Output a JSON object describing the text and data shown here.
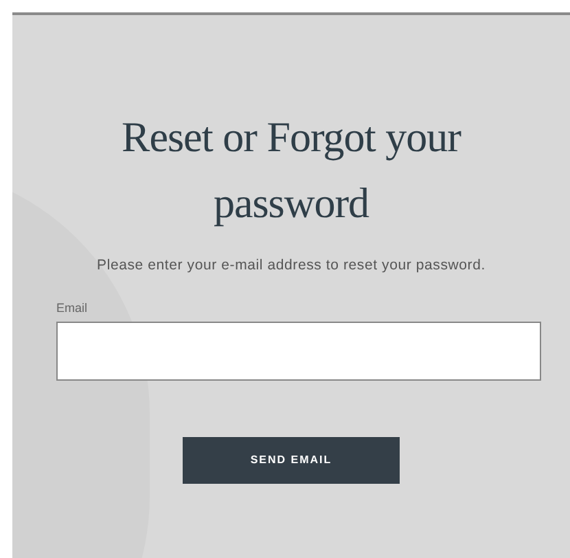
{
  "title": "Reset or Forgot your password",
  "instructions": "Please enter your e-mail address to reset your password.",
  "email_field": {
    "label": "Email"
  },
  "submit_button": {
    "label": "SEND EMAIL"
  }
}
